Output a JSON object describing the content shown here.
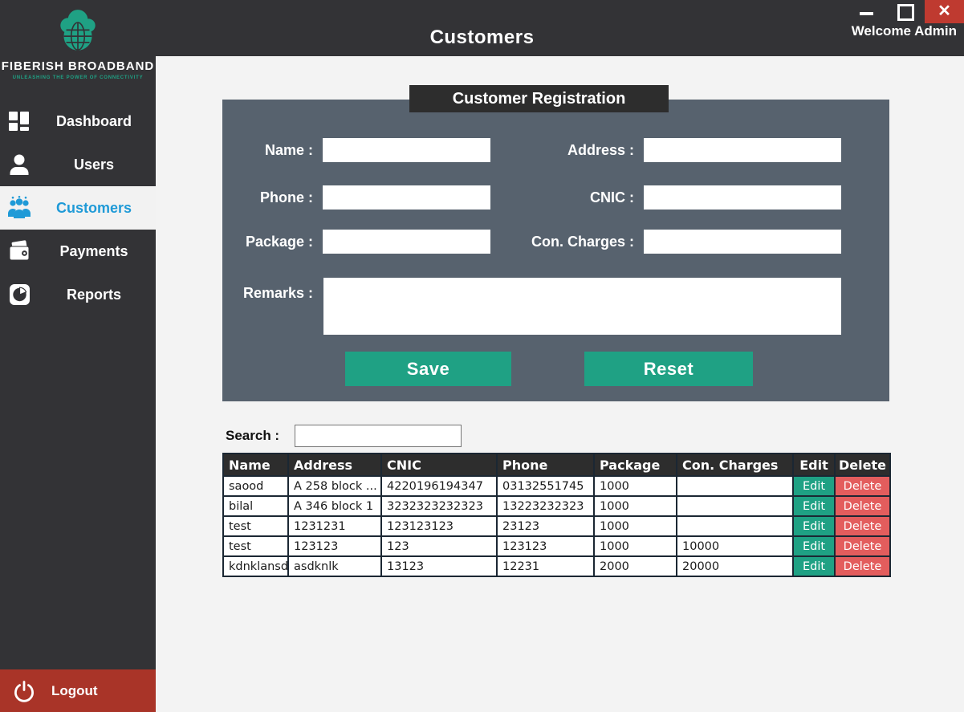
{
  "window": {
    "title": "Customers",
    "welcome": "Welcome Admin",
    "close_glyph": "✕"
  },
  "sidebar": {
    "logo": {
      "name": "FIBERISH BROADBAND",
      "tagline": "UNLEASHING THE POWER OF CONNECTIVITY"
    },
    "items": [
      {
        "label": "Dashboard",
        "icon": "dashboard-icon",
        "active": false
      },
      {
        "label": "Users",
        "icon": "user-icon",
        "active": false
      },
      {
        "label": "Customers",
        "icon": "customers-group-icon",
        "active": true
      },
      {
        "label": "Payments",
        "icon": "wallet-icon",
        "active": false
      },
      {
        "label": "Reports",
        "icon": "pie-chart-icon",
        "active": false
      }
    ],
    "logout": {
      "label": "Logout",
      "icon": "power-icon"
    }
  },
  "form": {
    "title": "Customer Registration",
    "fields": {
      "name": {
        "label": "Name :",
        "value": "",
        "placeholder": ""
      },
      "address": {
        "label": "Address :",
        "value": "",
        "placeholder": ""
      },
      "phone": {
        "label": "Phone :",
        "value": "",
        "placeholder": ""
      },
      "cnic": {
        "label": "CNIC :",
        "value": "",
        "placeholder": ""
      },
      "package": {
        "label": "Package :",
        "value": "",
        "placeholder": ""
      },
      "con_charges": {
        "label": "Con. Charges :",
        "value": "",
        "placeholder": ""
      },
      "remarks": {
        "label": "Remarks :",
        "value": "",
        "placeholder": ""
      }
    },
    "save_label": "Save",
    "reset_label": "Reset"
  },
  "search": {
    "label": "Search :",
    "value": "",
    "placeholder": ""
  },
  "table": {
    "headers": [
      "Name",
      "Address",
      "CNIC",
      "Phone",
      "Package",
      "Con. Charges",
      "Edit",
      "Delete"
    ],
    "edit_label": "Edit",
    "delete_label": "Delete",
    "rows": [
      {
        "name": "saood",
        "address": "A 258 block ...",
        "cnic": "4220196194347",
        "phone": "03132551745",
        "package": "1000",
        "con_charges": ""
      },
      {
        "name": "bilal",
        "address": "A 346 block 1",
        "cnic": "3232323232323",
        "phone": "13223232323",
        "package": "1000",
        "con_charges": ""
      },
      {
        "name": "test",
        "address": "1231231",
        "cnic": "123123123",
        "phone": "23123",
        "package": "1000",
        "con_charges": ""
      },
      {
        "name": "test",
        "address": "123123",
        "cnic": "123",
        "phone": "123123",
        "package": "1000",
        "con_charges": "10000"
      },
      {
        "name": "kdnklansd",
        "address": "asdknlk",
        "cnic": "13123",
        "phone": "12231",
        "package": "2000",
        "con_charges": "20000"
      }
    ]
  },
  "colors": {
    "accent_green": "#1fa184",
    "delete_red": "#e35d5d",
    "logout_red": "#a93428",
    "close_red": "#bf3a30",
    "active_blue": "#1f9ad7",
    "panel_slate": "#57626e",
    "dark_bar": "#333336",
    "table_header": "#2d2d2d"
  }
}
